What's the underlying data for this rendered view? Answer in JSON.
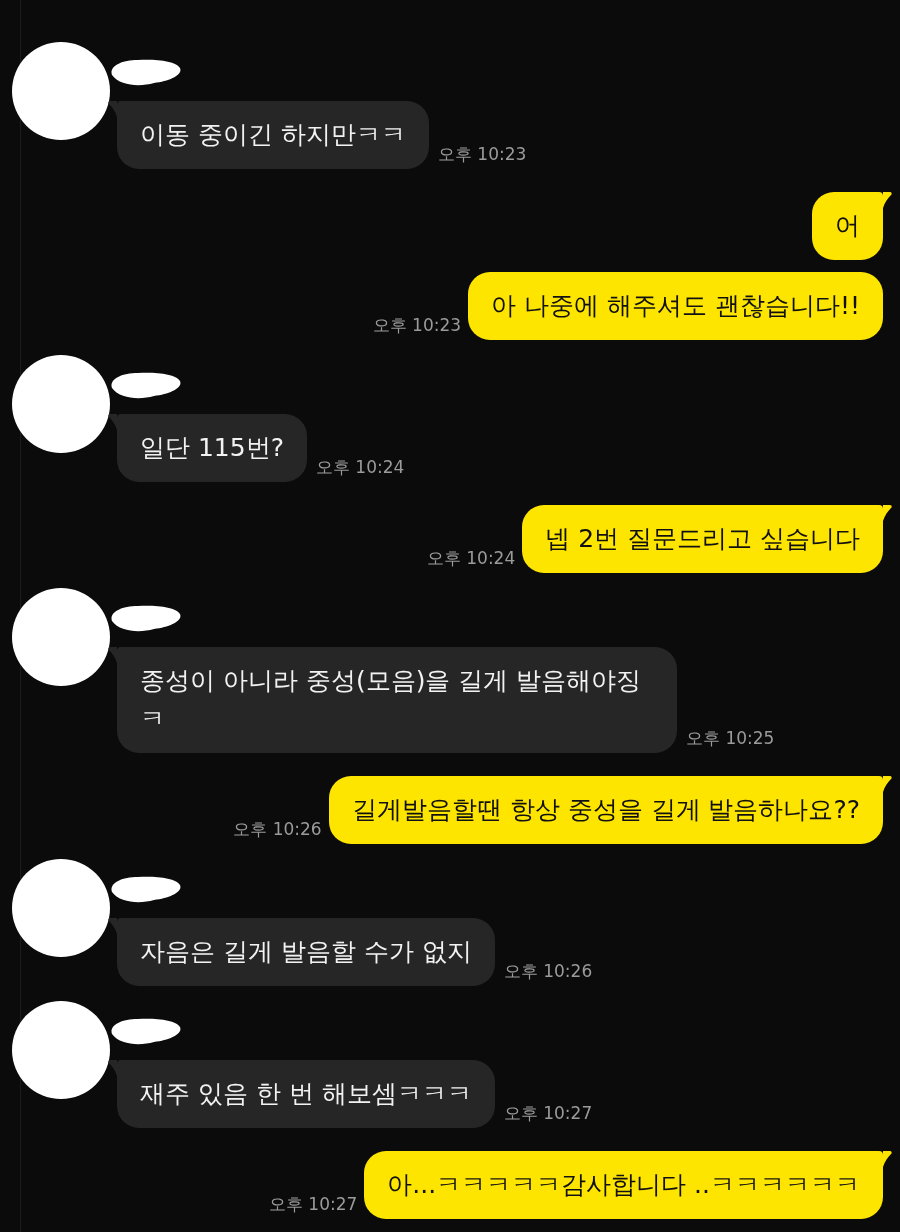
{
  "messages": [
    {
      "kind": "received",
      "tail": true,
      "text": "이동 중이긴 하지만ㅋㅋ",
      "time": "오후 10:23"
    },
    {
      "kind": "sent",
      "tail": true,
      "text": "어"
    },
    {
      "kind": "sent",
      "tail": false,
      "text": "아 나중에 해주셔도 괜찮습니다!!",
      "time": "오후 10:23"
    },
    {
      "kind": "received",
      "tail": true,
      "text": "일단 115번?",
      "time": "오후 10:24"
    },
    {
      "kind": "sent",
      "tail": true,
      "text": "넵 2번 질문드리고 싶습니다",
      "time": "오후 10:24"
    },
    {
      "kind": "received",
      "tail": true,
      "text": "종성이 아니라 중성(모음)을 길게 발음해야징ㅋ",
      "time": "오후 10:25"
    },
    {
      "kind": "sent",
      "tail": true,
      "text": "길게발음할땐 항상 중성을 길게 발음하나요??",
      "time": "오후 10:26"
    },
    {
      "kind": "received",
      "tail": true,
      "text": "자음은 길게 발음할 수가 없지",
      "time": "오후 10:26"
    },
    {
      "kind": "received",
      "tail": true,
      "text": "재주 있음 한 번 해보셈ㅋㅋㅋ",
      "time": "오후 10:27"
    },
    {
      "kind": "sent",
      "tail": true,
      "text": "아...ㅋㅋㅋㅋㅋ감사합니다 ..ㅋㅋㅋㅋㅋㅋ",
      "time": "오후 10:27"
    }
  ]
}
